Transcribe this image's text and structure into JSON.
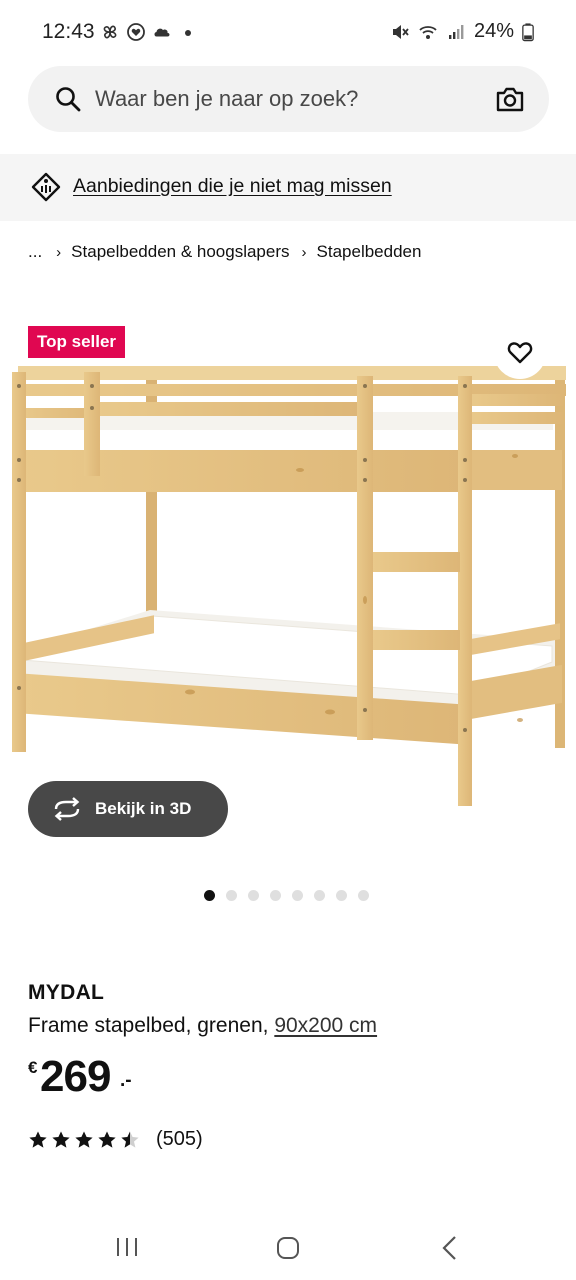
{
  "status_bar": {
    "time": "12:43",
    "battery": "24%",
    "icons_left": [
      "pinwheel-icon",
      "heart-location-icon",
      "cloud-icon",
      "dot-icon"
    ],
    "icons_right": [
      "mute-icon",
      "wifi-icon",
      "signal-icon",
      "battery-icon"
    ]
  },
  "search": {
    "placeholder": "Waar ben je naar op zoek?",
    "icon": "search-icon",
    "camera_icon": "camera-icon"
  },
  "promo": {
    "text": "Aanbiedingen die je niet mag missen",
    "icon": "tag-icon"
  },
  "breadcrumb": {
    "ellipsis": "...",
    "items": [
      "Stapelbedden & hoogslapers",
      "Stapelbedden"
    ]
  },
  "product": {
    "badge": "Top seller",
    "view_3d": "Bekijk in 3D",
    "image_count": 8,
    "active_image": 1,
    "name": "MYDAL",
    "description": "Frame stapelbed, grenen,",
    "size": "90x200 cm",
    "price": {
      "currency": "€",
      "integer": "269",
      "decimal": ".-"
    },
    "rating": {
      "value": 4.5,
      "max": 5,
      "count": "(505)"
    }
  },
  "colors": {
    "badge": "#e00751",
    "button_dark": "#484848",
    "search_bg": "#f2f2f2",
    "wood": "#e8c88a"
  }
}
